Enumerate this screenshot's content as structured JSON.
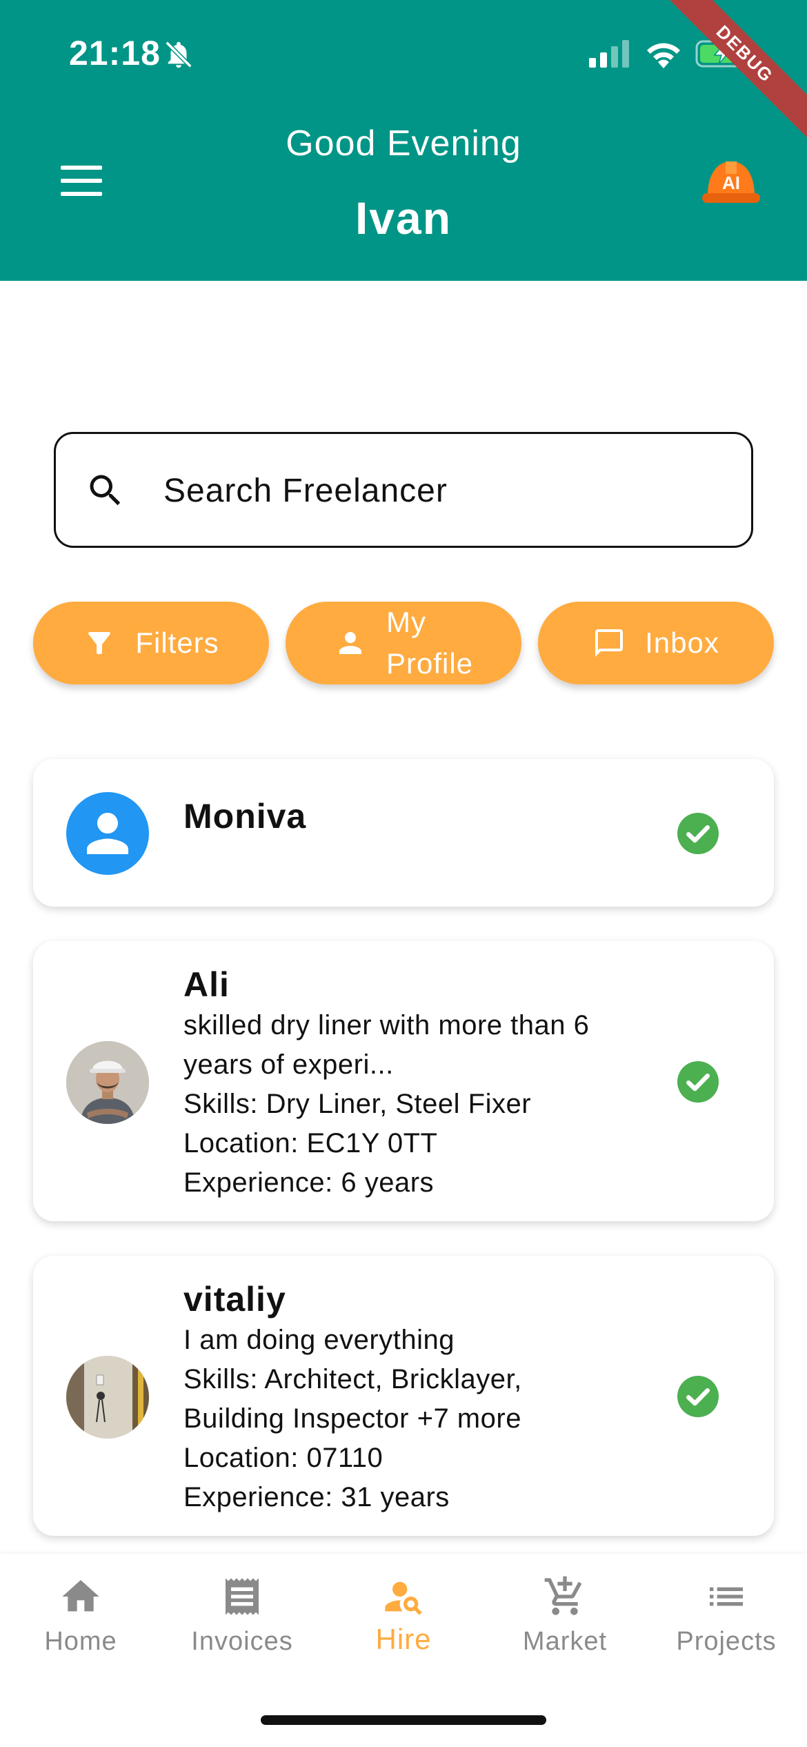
{
  "status_bar": {
    "time": "21:18"
  },
  "debug_banner": "DEBUG",
  "header": {
    "greeting": "Good Evening",
    "username": "Ivan",
    "ai_badge": "AI"
  },
  "search": {
    "placeholder": "Search Freelancer",
    "value": ""
  },
  "actions": {
    "filters": "Filters",
    "profile_line1": "My",
    "profile_line2": "Profile",
    "inbox": "Inbox"
  },
  "freelancers": [
    {
      "name": "Moniva",
      "verified": true
    },
    {
      "name": "Ali",
      "bio_line1": "skilled dry liner with more than 6",
      "bio_line2": "years of experi...",
      "skills": "Skills: Dry Liner, Steel Fixer",
      "location": "Location: EC1Y 0TT",
      "experience": "Experience: 6 years",
      "verified": true
    },
    {
      "name": "vitaliy",
      "bio": "I am doing everything",
      "skills_line1": "Skills: Architect, Bricklayer,",
      "skills_line2": "Building Inspector +7 more",
      "location": "Location: 07110",
      "experience": "Experience: 31 years",
      "verified": true
    }
  ],
  "bottom_nav": {
    "home": "Home",
    "invoices": "Invoices",
    "hire": "Hire",
    "market": "Market",
    "projects": "Projects",
    "active": "Hire"
  },
  "colors": {
    "primary": "#009586",
    "accent": "#ffab40",
    "verified": "#4caf50",
    "avatar_default": "#2196f3"
  }
}
